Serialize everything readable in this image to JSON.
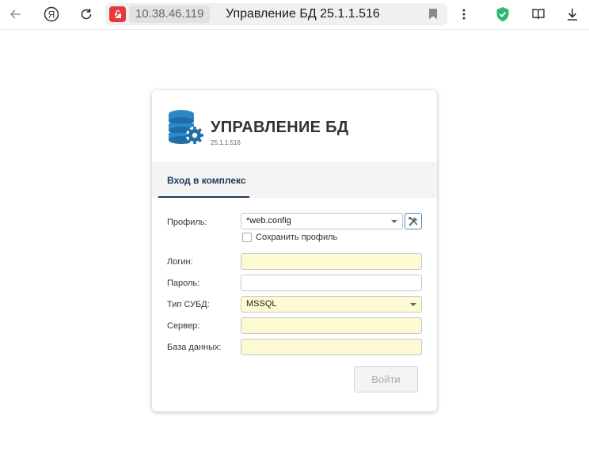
{
  "browser": {
    "address": "10.38.46.119",
    "tab_title": "Управление БД 25.1.1.516"
  },
  "app": {
    "title": "УПРАВЛЕНИЕ БД",
    "version": "25.1.1.516"
  },
  "tabs": {
    "active_label": "Вход в комплекс"
  },
  "form": {
    "profile_label": "Профиль:",
    "profile_value": "*web.config",
    "save_profile_label": "Сохранить профиль",
    "save_profile_checked": false,
    "login_label": "Логин:",
    "login_value": "",
    "password_label": "Пароль:",
    "password_value": "",
    "dbms_label": "Тип СУБД:",
    "dbms_value": "MSSQL",
    "server_label": "Сервер:",
    "server_value": "",
    "database_label": "База данных:",
    "database_value": "",
    "submit_label": "Войти"
  },
  "colors": {
    "accent": "#1d3a5c",
    "required_field_bg": "#fdf9d2",
    "security_badge": "#e53a3a",
    "shield": "#2eb872"
  }
}
